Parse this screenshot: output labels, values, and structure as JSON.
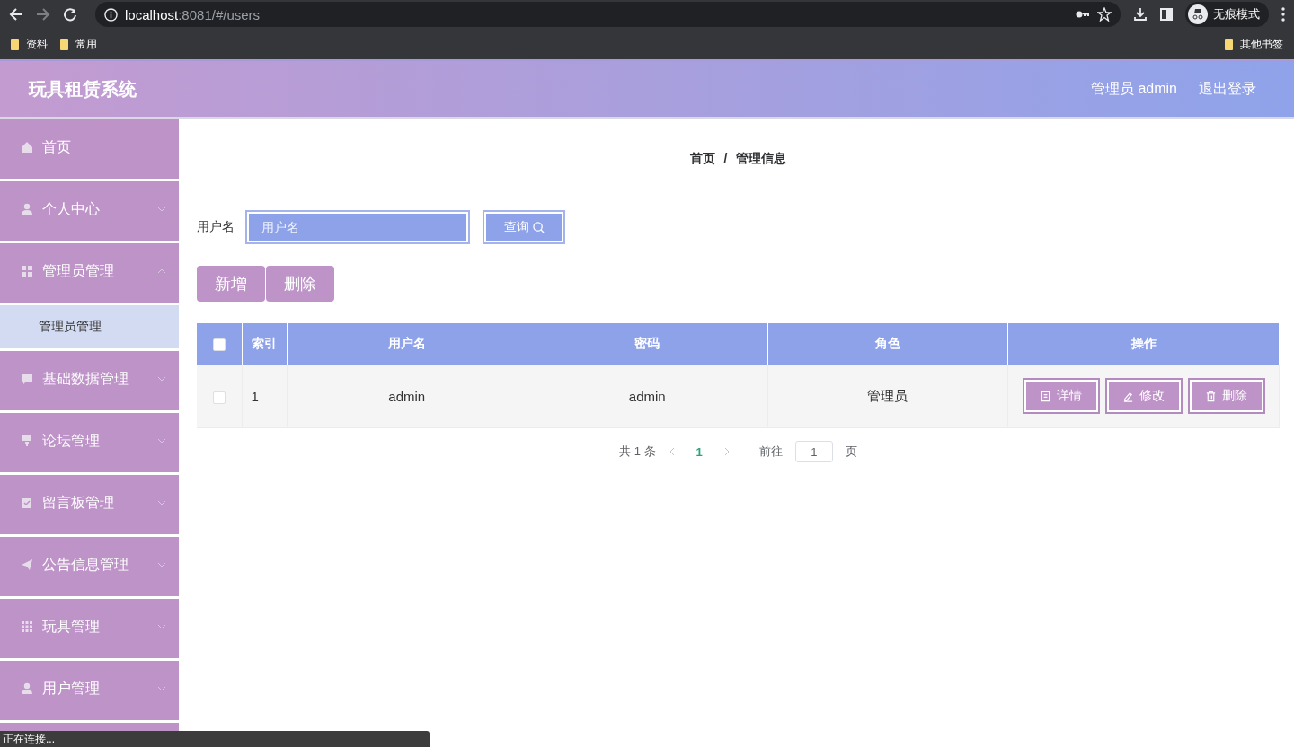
{
  "browser": {
    "url_host": "localhost",
    "url_rest": ":8081/#/users",
    "profile": "无痕模式",
    "bookmarks": [
      "资料",
      "常用"
    ],
    "other_bookmarks": "其他书签",
    "status": "正在连接..."
  },
  "header": {
    "title": "玩具租赁系统",
    "user": "管理员 admin",
    "logout": "退出登录"
  },
  "sidebar": {
    "items": [
      {
        "label": "首页",
        "kind": "link"
      },
      {
        "label": "个人中心",
        "kind": "menu"
      },
      {
        "label": "管理员管理",
        "kind": "menu",
        "children": [
          {
            "label": "管理员管理",
            "selected": true
          }
        ]
      },
      {
        "label": "基础数据管理",
        "kind": "menu"
      },
      {
        "label": "论坛管理",
        "kind": "menu"
      },
      {
        "label": "留言板管理",
        "kind": "menu"
      },
      {
        "label": "公告信息管理",
        "kind": "menu"
      },
      {
        "label": "玩具管理",
        "kind": "menu"
      },
      {
        "label": "用户管理",
        "kind": "menu"
      }
    ]
  },
  "breadcrumb": {
    "items": [
      "首页",
      "管理信息"
    ],
    "separator": "/"
  },
  "search": {
    "label": "用户名",
    "placeholder": "用户名",
    "button": "查询"
  },
  "actions": [
    "新增",
    "删除"
  ],
  "table": {
    "header_checked": false,
    "columns": [
      "索引",
      "用户名",
      "密码",
      "角色",
      "操作"
    ],
    "rows": [
      {
        "checked": false,
        "cells": [
          "1",
          "admin",
          "admin",
          "管理员"
        ],
        "buttons": [
          "详情",
          "修改",
          "删除"
        ]
      }
    ]
  },
  "pagination": {
    "total": "共 1 条",
    "pages": [
      {
        "label": "1",
        "selected": true
      }
    ],
    "goto": "前往",
    "page_value": "1",
    "page_unit": "页"
  }
}
